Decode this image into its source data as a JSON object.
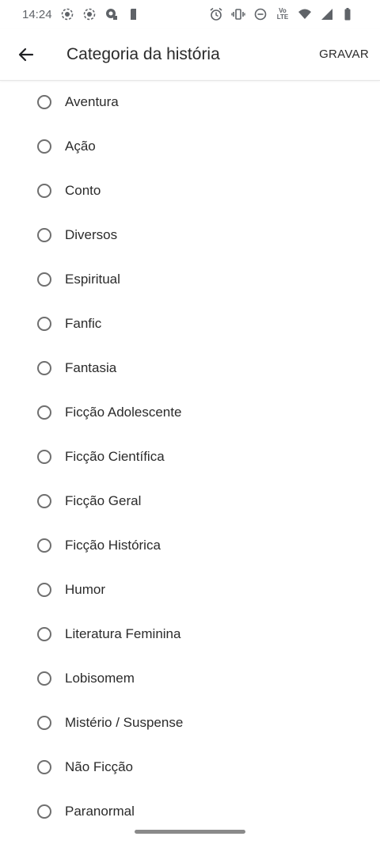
{
  "status_bar": {
    "time": "14:24",
    "lte_label_top": "Vo",
    "lte_label_bottom": "LTE",
    "icons_left": [
      "screen-record-icon",
      "screen-record-icon",
      "cast-icon",
      "sim-card-icon"
    ],
    "icons_right": [
      "alarm-icon",
      "vibrate-icon",
      "do-not-disturb-icon",
      "volte-icon",
      "wifi-icon",
      "cell-signal-icon",
      "battery-icon"
    ]
  },
  "app_bar": {
    "title": "Categoria da história",
    "save_label": "GRAVAR",
    "back_icon": "arrow-back-icon"
  },
  "categories": [
    {
      "label": "Aventura",
      "selected": false
    },
    {
      "label": "Ação",
      "selected": false
    },
    {
      "label": "Conto",
      "selected": false
    },
    {
      "label": "Diversos",
      "selected": false
    },
    {
      "label": "Espiritual",
      "selected": false
    },
    {
      "label": "Fanfic",
      "selected": false
    },
    {
      "label": "Fantasia",
      "selected": false
    },
    {
      "label": "Ficção Adolescente",
      "selected": false
    },
    {
      "label": "Ficção Científica",
      "selected": false
    },
    {
      "label": "Ficção Geral",
      "selected": false
    },
    {
      "label": "Ficção Histórica",
      "selected": false
    },
    {
      "label": "Humor",
      "selected": false
    },
    {
      "label": "Literatura Feminina",
      "selected": false
    },
    {
      "label": "Lobisomem",
      "selected": false
    },
    {
      "label": "Mistério / Suspense",
      "selected": false
    },
    {
      "label": "Não Ficção",
      "selected": false
    },
    {
      "label": "Paranormal",
      "selected": false
    }
  ],
  "colors": {
    "text": "#2b2b2b",
    "radio_border": "#6f6f6f",
    "status_icons": "#5f6368",
    "divider": "#e6e6e6"
  }
}
